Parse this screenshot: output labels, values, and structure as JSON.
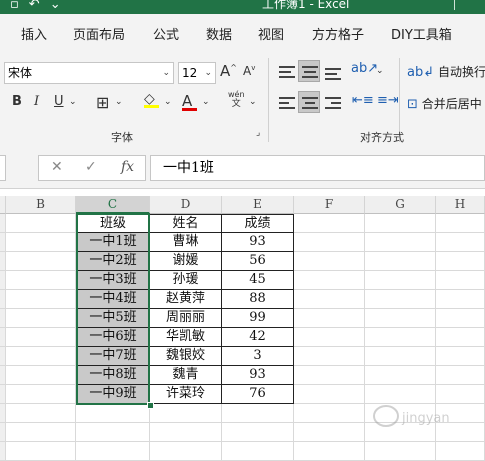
{
  "window": {
    "title": "工作簿1 - Excel"
  },
  "ribbon_tabs": [
    "插入",
    "页面布局",
    "公式",
    "数据",
    "视图",
    "方方格子",
    "DIY工具箱"
  ],
  "font": {
    "name": "宋体",
    "size": "12"
  },
  "format_buttons": {
    "bold": "B",
    "italic": "I",
    "underline": "U"
  },
  "buttons": {
    "wrap_text": "自动换行",
    "merge_center": "合并后居中",
    "phonetic_top": "wén",
    "phonetic_bottom": "文"
  },
  "groups": {
    "font": "字体",
    "alignment": "对齐方式"
  },
  "formula_bar": {
    "value": "一中1班",
    "fx": "fx"
  },
  "columns": [
    "B",
    "C",
    "D",
    "E",
    "F",
    "G",
    "H"
  ],
  "table": {
    "headers": [
      "班级",
      "姓名",
      "成绩"
    ],
    "rows": [
      [
        "一中1班",
        "曹琳",
        "93"
      ],
      [
        "一中2班",
        "谢媛",
        "56"
      ],
      [
        "一中3班",
        "孙瑗",
        "45"
      ],
      [
        "一中4班",
        "赵黄萍",
        "88"
      ],
      [
        "一中5班",
        "周丽丽",
        "99"
      ],
      [
        "一中6班",
        "华凯敏",
        "42"
      ],
      [
        "一中7班",
        "魏银姣",
        "3"
      ],
      [
        "一中8班",
        "魏青",
        "93"
      ],
      [
        "一中9班",
        "许菜玲",
        "76"
      ]
    ]
  },
  "colors": {
    "brand": "#217346",
    "font_color": "#e00000",
    "highlight": "#ffff00"
  }
}
